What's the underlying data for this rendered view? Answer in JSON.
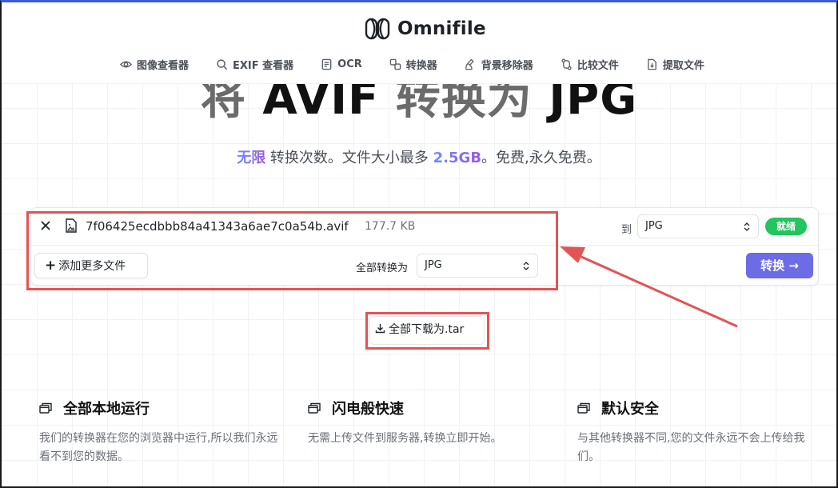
{
  "brand": {
    "name": "Omnifile"
  },
  "nav": [
    {
      "label": "图像查看器",
      "icon": "eye-icon"
    },
    {
      "label": "EXIF 查看器",
      "icon": "search-icon"
    },
    {
      "label": "OCR",
      "icon": "document-text-icon"
    },
    {
      "label": "转换器",
      "icon": "convert-icon"
    },
    {
      "label": "背景移除器",
      "icon": "brush-icon"
    },
    {
      "label": "比较文件",
      "icon": "compare-icon"
    },
    {
      "label": "提取文件",
      "icon": "extract-file-icon"
    }
  ],
  "hero": {
    "title_part1": "将 ",
    "title_part2": "AVIF",
    "title_part3": " 转换为 ",
    "title_part4": "JPG"
  },
  "subtitle": {
    "highlight1": "无限",
    "text1": " 转换次数。文件大小最多 ",
    "highlight2": "2.5GB",
    "text2": "。免费,永久免费。"
  },
  "converter": {
    "file_name": "7f06425ecdbbb84a41343a6ae7c0a54b.avif",
    "file_size": "177.7 KB",
    "to_label": "到",
    "target_format": "JPG",
    "status": "就绪",
    "add_more_label": "添加更多文件",
    "convert_all_label": "全部转换为",
    "convert_all_format": "JPG",
    "convert_button": "转换 →"
  },
  "download": {
    "label": "全部下载为.tar"
  },
  "features": [
    {
      "title": "全部本地运行",
      "desc": "我们的转换器在您的浏览器中运行,所以我们永远看不到您的数据。"
    },
    {
      "title": "闪电般快速",
      "desc": "无需上传文件到服务器,转换立即开始。"
    },
    {
      "title": "默认安全",
      "desc": "与其他转换器不同,您的文件永远不会上传给我们。"
    }
  ],
  "colors": {
    "accent": "#6b6ce6",
    "ready": "#22c55e",
    "annotation": "#e35454"
  }
}
